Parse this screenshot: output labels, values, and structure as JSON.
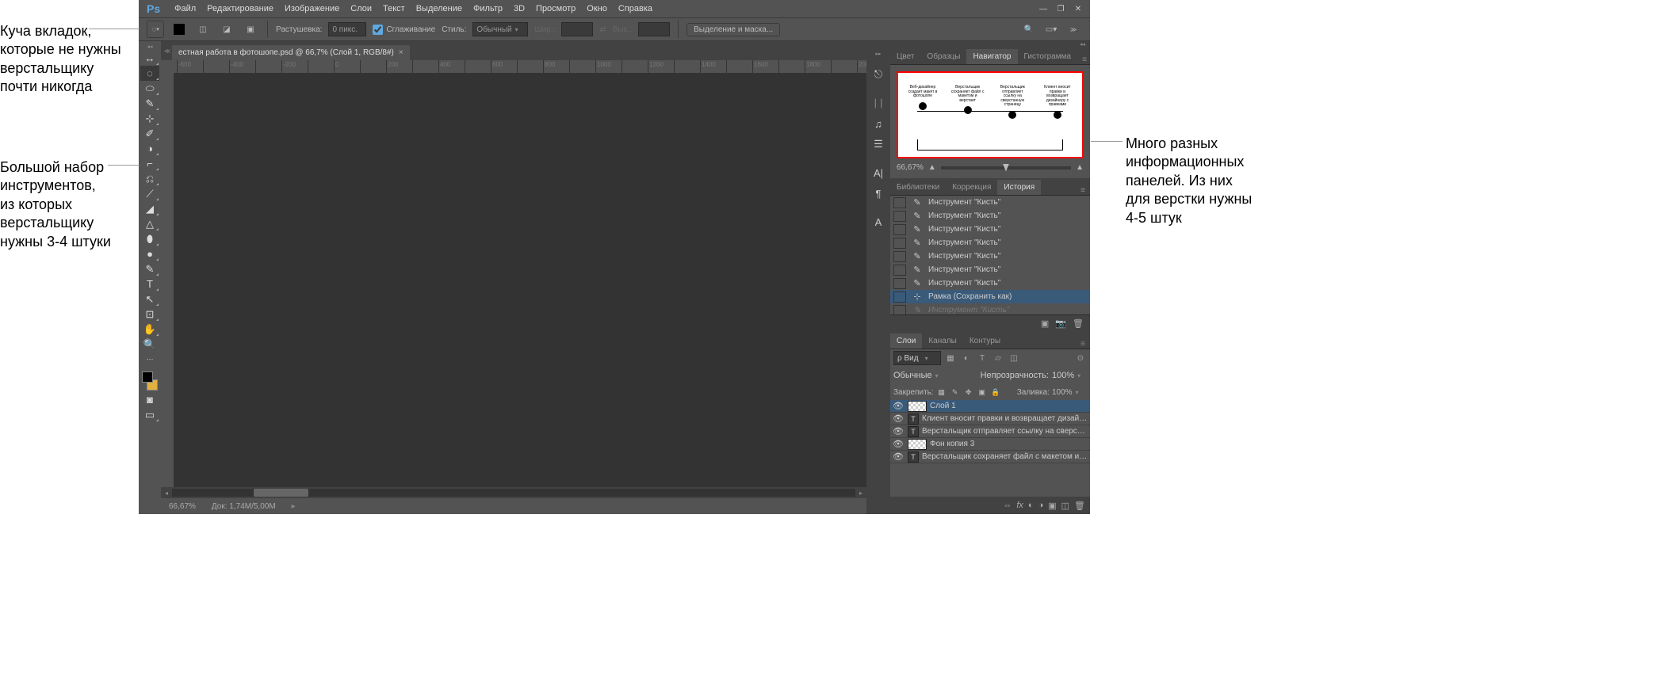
{
  "annotations": {
    "top_left": "Куча вкладок,\nкоторые не нужны\nверстальщику\nпочти никогда",
    "mid_left": "Большой набор\nинструментов,\nиз которых\nверстальщику\nнужны 3-4 штуки",
    "right": "Много разных\nинформационных\nпанелей. Из них\nдля верстки нужны\n4-5 штук"
  },
  "menubar": {
    "logo": "Ps",
    "items": [
      "Файл",
      "Редактирование",
      "Изображение",
      "Слои",
      "Текст",
      "Выделение",
      "Фильтр",
      "3D",
      "Просмотр",
      "Окно",
      "Справка"
    ]
  },
  "optbar": {
    "feather_label": "Растушевка:",
    "feather_value": "0 пикс.",
    "smoothing": "Сглаживание",
    "style_label": "Стиль:",
    "style_value": "Обычный",
    "width_label": "Шир.:",
    "height_label": "Выс.:",
    "mask_btn": "Выделение и маска..."
  },
  "doc_tab": "естная работа в фотошопе.psd @ 66,7% (Слой 1, RGB/8#)",
  "statusbar": {
    "zoom": "66,67%",
    "doc": "Док: 1,74M/5,00M"
  },
  "tools": [
    "↔",
    "◌",
    "⬭",
    "✎",
    "⊹",
    "✐",
    "◑",
    "⌐",
    "⎌",
    "⟋",
    "◢",
    "△",
    "⬮",
    "●",
    "✎",
    "⊡",
    "T",
    "↖",
    "✋",
    "🔍"
  ],
  "iconcol": [
    "⎋",
    "ᛁᛁ",
    "♫",
    "☰",
    "A|",
    "¶",
    "A"
  ],
  "panels": {
    "group1_tabs": [
      "Цвет",
      "Образцы",
      "Навигатор",
      "Гистограмма"
    ],
    "group1_active": 2,
    "nav_zoom": "66,67%",
    "nav_stages": [
      "Веб-дизайнер создает макет в фотошопе",
      "Верстальщик сохраняет файл с макетом и верстает",
      "Верстальщик отправляет ссылку на сверстанную страницу",
      "Клиент вносит правки и возвращает дизайнеру с правками"
    ],
    "group2_tabs": [
      "Библиотеки",
      "Коррекция",
      "История"
    ],
    "group2_active": 2,
    "history_items": [
      {
        "label": "Инструмент \"Кисть\"",
        "icon": "✎"
      },
      {
        "label": "Инструмент \"Кисть\"",
        "icon": "✎"
      },
      {
        "label": "Инструмент \"Кисть\"",
        "icon": "✎"
      },
      {
        "label": "Инструмент \"Кисть\"",
        "icon": "✎"
      },
      {
        "label": "Инструмент \"Кисть\"",
        "icon": "✎"
      },
      {
        "label": "Инструмент \"Кисть\"",
        "icon": "✎"
      },
      {
        "label": "Инструмент \"Кисть\"",
        "icon": "✎"
      },
      {
        "label": "Рамка (Сохранить как)",
        "icon": "⊹",
        "active": true
      },
      {
        "label": "Инструмент \"Кисть\"",
        "icon": "✎",
        "dim": true
      }
    ],
    "group3_tabs": [
      "Слои",
      "Каналы",
      "Контуры"
    ],
    "group3_active": 0,
    "layers": {
      "filter_label": "ρ Вид",
      "blend_mode": "Обычные",
      "opacity_label": "Непрозрачность:",
      "opacity_value": "100%",
      "lock_label": "Закрепить:",
      "fill_label": "Заливка:",
      "fill_value": "100%",
      "items": [
        {
          "name": "Слой 1",
          "type": "pixel",
          "active": true
        },
        {
          "name": "Клиент вносит  правки и возвращает  дизайнеру ...",
          "type": "T"
        },
        {
          "name": "Верстальщик  отправляет ссылку на сверстанную ...",
          "type": "T"
        },
        {
          "name": "Фон копия 3",
          "type": "pixel"
        },
        {
          "name": "Верстальщик  сохраняет файл с макетом и верстает",
          "type": "T"
        }
      ]
    }
  }
}
